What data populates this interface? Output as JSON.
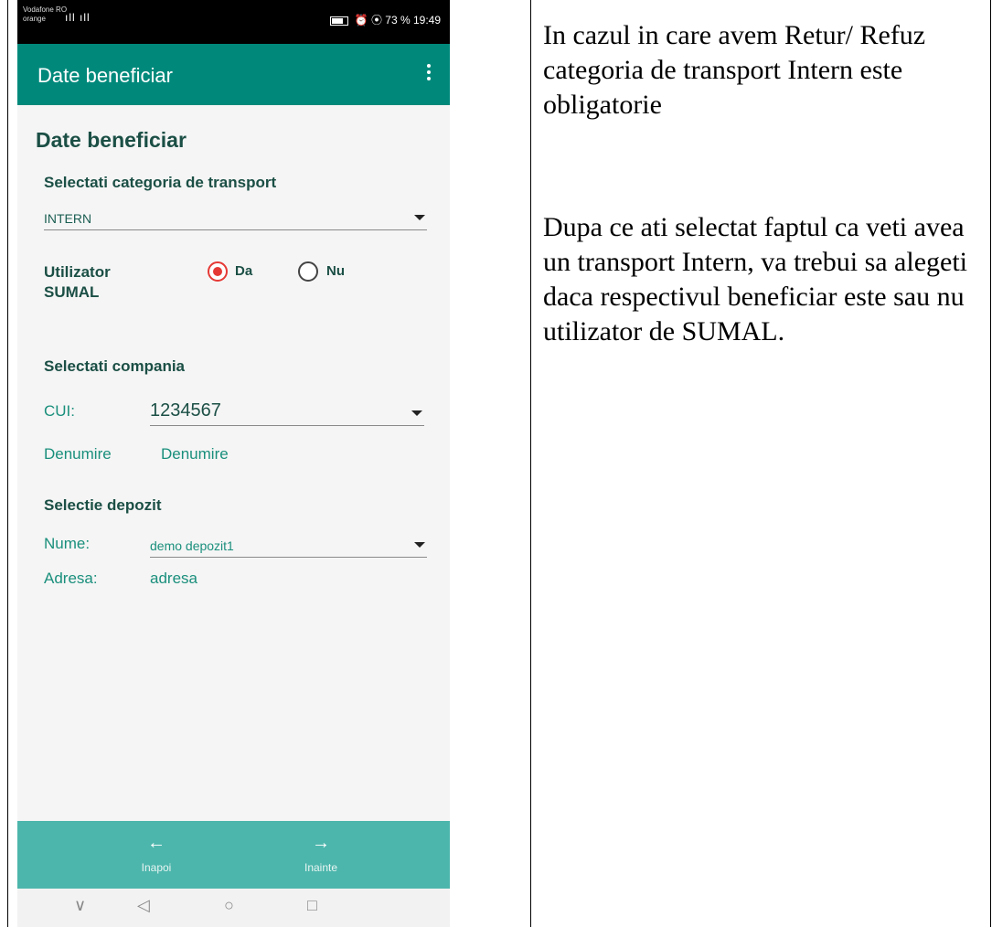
{
  "statusbar": {
    "carrier_top": "Vodafone RO",
    "carrier_bottom": "orange",
    "signal": "ıll ıll",
    "right_text": "⏰ ⦿ 73 %  19:49"
  },
  "appbar": {
    "title": "Date beneficiar"
  },
  "form": {
    "section_title": "Date beneficiar",
    "transport_label": "Selectati categoria de transport",
    "transport_value": "INTERN",
    "utilizator_label_1": "Utilizator",
    "utilizator_label_2": "SUMAL",
    "radio_da": "Da",
    "radio_nu": "Nu",
    "compania_label": "Selectati compania",
    "cui_label": "CUI:",
    "cui_value": "1234567",
    "denumire_label": "Denumire",
    "denumire_value": "Denumire",
    "depozit_label": "Selectie depozit",
    "nume_label": "Nume:",
    "nume_value": "demo depozit1",
    "adresa_label": "Adresa:",
    "adresa_value": "adresa"
  },
  "bottomnav": {
    "back_icon": "←",
    "back_label": "Inapoi",
    "next_icon": "→",
    "next_label": "Inainte"
  },
  "sysnav": {
    "down": "∨",
    "back": "◁",
    "home": "○",
    "recent": "□"
  },
  "explanation": {
    "paragraph_1": "In cazul in care avem Retur/ Refuz categoria de transport Intern este obligatorie",
    "paragraph_2": "Dupa ce ati selectat faptul ca veti avea un transport Intern, va trebui sa alegeti daca respectivul beneficiar este sau nu utilizator de SUMAL."
  },
  "colors": {
    "appbar": "#00897b",
    "bottomnav": "#4db6ac",
    "radio_selected": "#e53935",
    "label_dark": "#1b4f45",
    "label_teal": "#1a8f7c"
  },
  "icons": [
    "menu-dots-icon",
    "arrow-left-icon",
    "arrow-right-icon",
    "dropdown-arrow-icon",
    "battery-icon"
  ]
}
